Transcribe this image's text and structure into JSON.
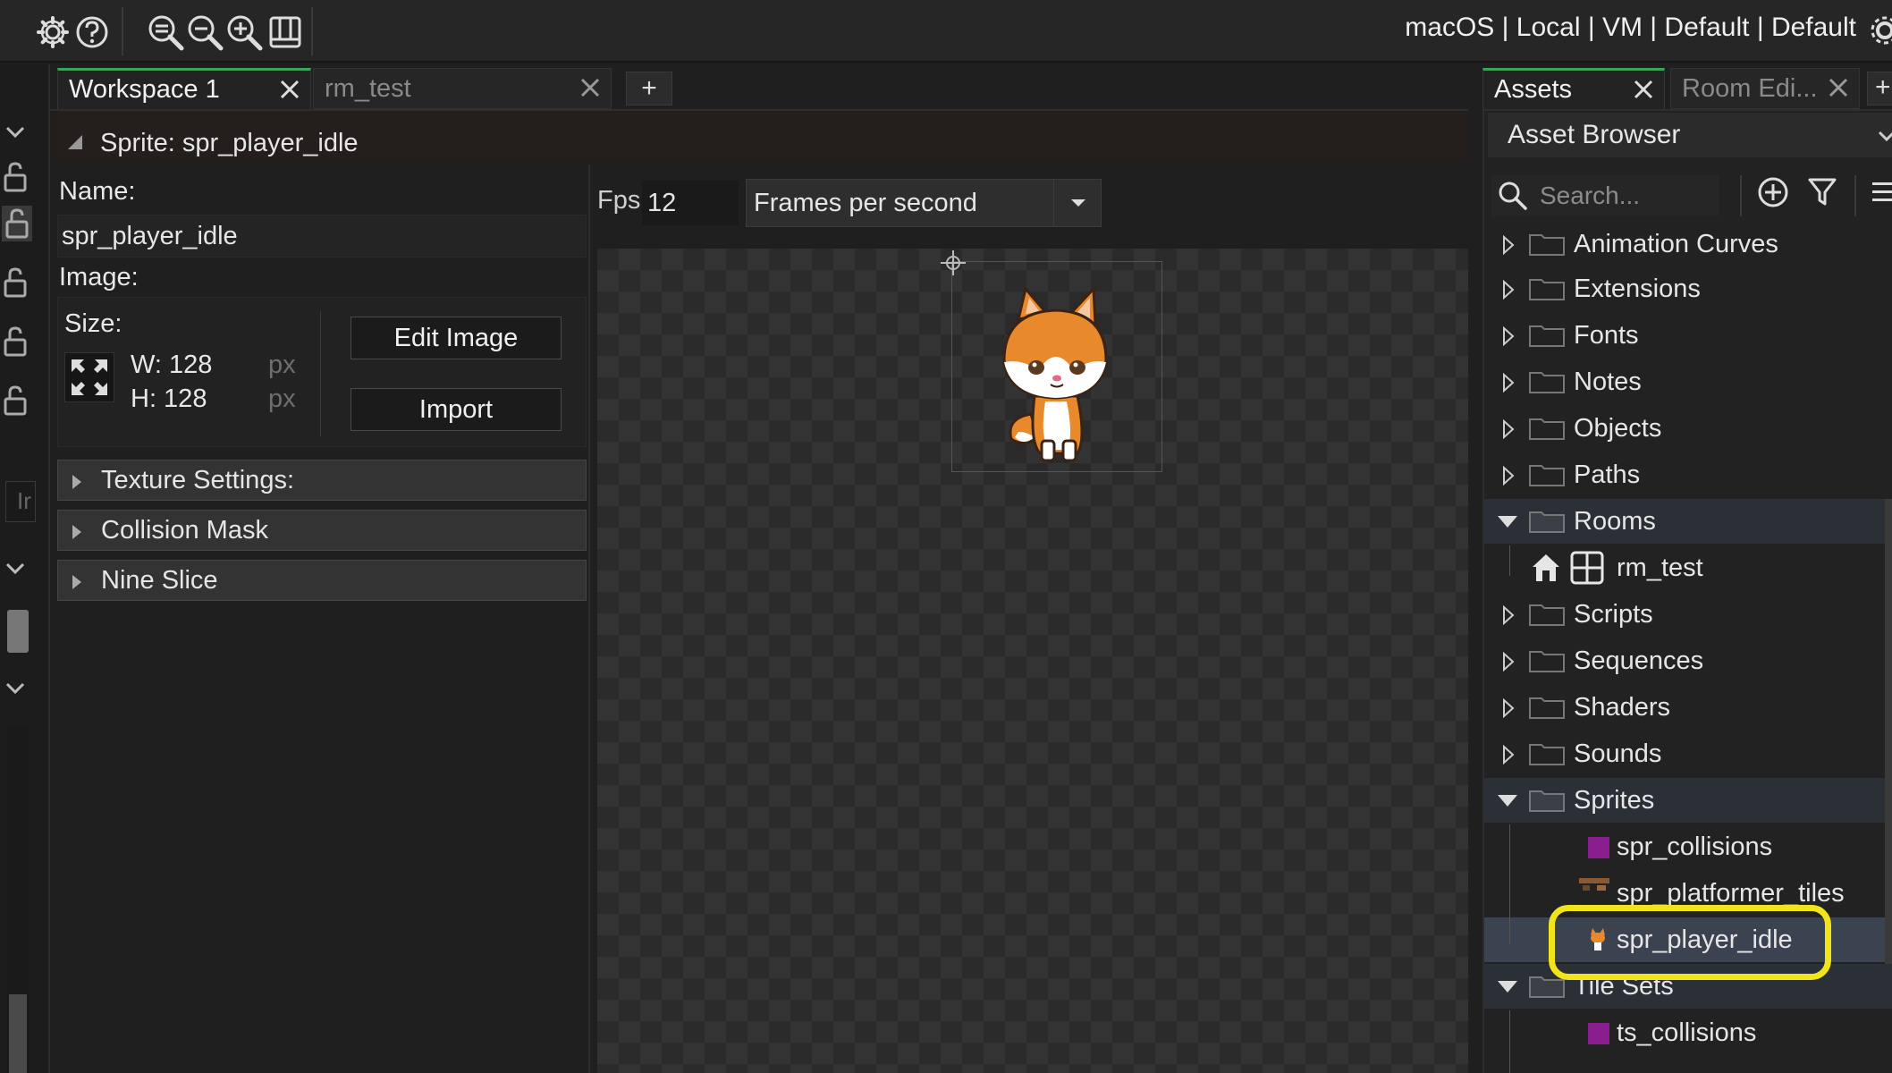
{
  "toolbar": {
    "target_text": "macOS | Local | VM | Default | Default",
    "buttons": [
      "gear-icon",
      "help-icon",
      "zoom-reset-icon",
      "zoom-out-icon",
      "zoom-in-icon",
      "layout-icon"
    ]
  },
  "left_strip": {
    "input_stub": "Ir"
  },
  "workspace_tabs": [
    {
      "label": "Workspace 1",
      "active": true
    },
    {
      "label": "rm_test",
      "active": false
    }
  ],
  "tab_add_label": "+",
  "sprite_editor": {
    "header": "Sprite: spr_player_idle",
    "name_label": "Name:",
    "name_value": "spr_player_idle",
    "image_label": "Image:",
    "size_label": "Size:",
    "width_text": "W: 128",
    "height_text": "H: 128",
    "unit": "px",
    "edit_image_button": "Edit Image",
    "import_button": "Import",
    "sections": [
      "Texture Settings:",
      "Collision Mask",
      "Nine Slice"
    ],
    "fps_label": "Fps",
    "fps_value": "12",
    "fps_mode": "Frames per second"
  },
  "right_tabs": [
    {
      "label": "Assets",
      "active": true
    },
    {
      "label": "Room Edi...",
      "active": false
    }
  ],
  "asset_browser": {
    "title": "Asset Browser",
    "search_placeholder": "Search...",
    "tree": [
      {
        "label": "Animation Curves",
        "type": "folder",
        "open": false
      },
      {
        "label": "Extensions",
        "type": "folder",
        "open": false
      },
      {
        "label": "Fonts",
        "type": "folder",
        "open": false
      },
      {
        "label": "Notes",
        "type": "folder",
        "open": false
      },
      {
        "label": "Objects",
        "type": "folder",
        "open": false
      },
      {
        "label": "Paths",
        "type": "folder",
        "open": false
      },
      {
        "label": "Rooms",
        "type": "folder",
        "open": true
      },
      {
        "label": "rm_test",
        "type": "room"
      },
      {
        "label": "Scripts",
        "type": "folder",
        "open": false
      },
      {
        "label": "Sequences",
        "type": "folder",
        "open": false
      },
      {
        "label": "Shaders",
        "type": "folder",
        "open": false
      },
      {
        "label": "Sounds",
        "type": "folder",
        "open": false
      },
      {
        "label": "Sprites",
        "type": "folder",
        "open": true
      },
      {
        "label": "spr_collisions",
        "type": "sprite"
      },
      {
        "label": "spr_platformer_tiles",
        "type": "sprite"
      },
      {
        "label": "spr_player_idle",
        "type": "sprite",
        "selected": true
      },
      {
        "label": "Tile Sets",
        "type": "folder",
        "open": true
      },
      {
        "label": "ts_collisions",
        "type": "tileset"
      }
    ]
  },
  "colors": {
    "accent_green": "#3aa35c",
    "highlight_yellow": "#f2e41b",
    "selection": "#3b4250",
    "sprite_purple": "#8b1e8e"
  }
}
